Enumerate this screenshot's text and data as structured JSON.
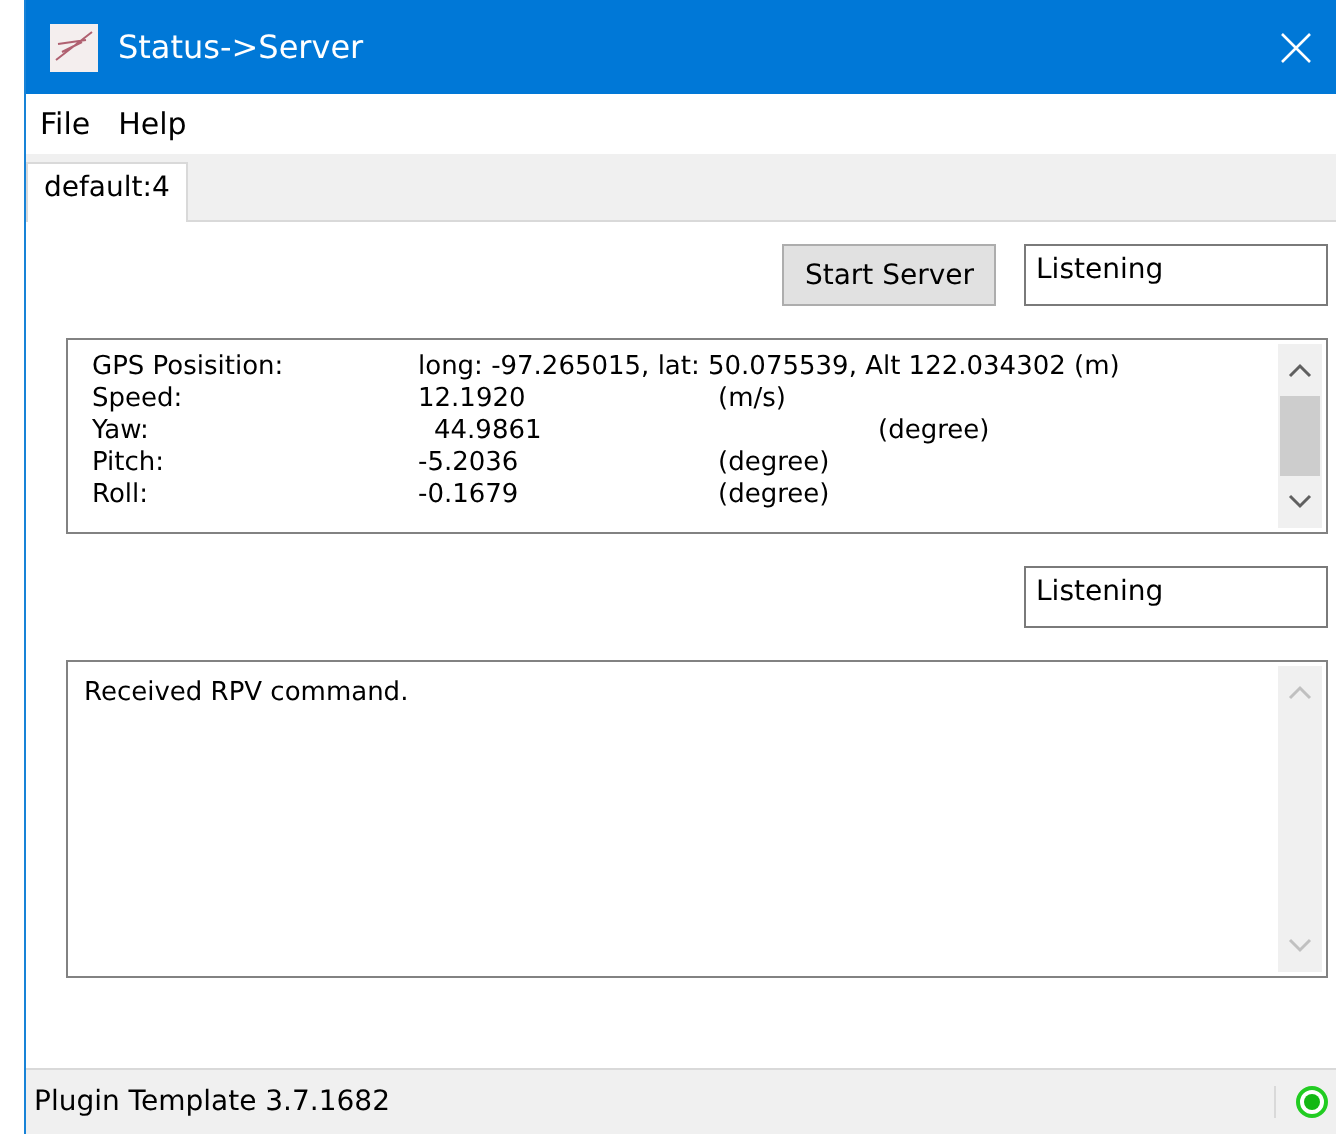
{
  "window": {
    "title": "Status->Server"
  },
  "menu": [
    "File",
    "Help"
  ],
  "tabs": [
    {
      "label": "default:4",
      "selected": true
    }
  ],
  "start_button": "Start Server",
  "server_state": "Listening",
  "telemetry": [
    {
      "label": "GPS Posisition:",
      "value": "long: -97.265015, lat: 50.075539, Alt 122.034302 (m)",
      "kind": "span"
    },
    {
      "label": "Speed:",
      "value": "12.1920",
      "unit": "(m/s)",
      "kind": "near"
    },
    {
      "label": "Yaw:",
      "value": "44.9861",
      "unit": "(degree)",
      "kind": "far"
    },
    {
      "label": "Pitch:",
      "value": "-5.2036",
      "unit": "(degree)",
      "kind": "near"
    },
    {
      "label": "Roll:",
      "value": "-0.1679",
      "unit": "(degree)",
      "kind": "near"
    }
  ],
  "client_state": "Listening",
  "log": [
    "Received RPV command."
  ],
  "status_bar": {
    "text": "Plugin Template 3.7.1682",
    "connected": true
  }
}
